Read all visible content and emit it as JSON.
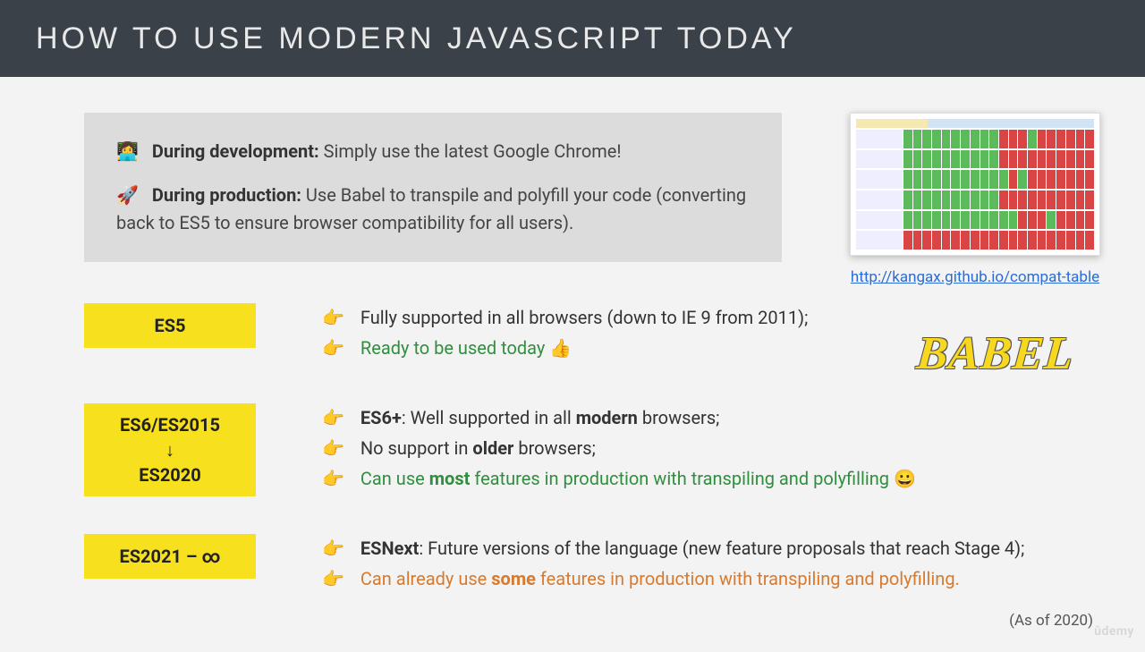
{
  "header": {
    "title": "How to use modern JavaScript today"
  },
  "infobox": {
    "dev_icon": "👩‍💻",
    "dev_label": "During development:",
    "dev_text": "Simply use the latest Google Chrome!",
    "prod_icon": "🚀",
    "prod_label": "During production:",
    "prod_text": "Use Babel to transpile and polyfill your code (converting back to ES5 to ensure browser compatibility for all users)."
  },
  "compat": {
    "link_text": "http://kangax.github.io/compat-table",
    "link_href": "http://kangax.github.io/compat-table"
  },
  "babel_logo_text": "BABEL",
  "tags": {
    "es5": "ES5",
    "es6_l1": "ES6/ES2015",
    "es6_arrow": "↓",
    "es6_l3": "ES2020",
    "esnext": "ES2021 – ∞"
  },
  "bullets": {
    "es5_1": "Fully supported in all browsers (down to IE 9 from 2011);",
    "es5_2_pre": "Ready to be used today ",
    "es5_2_emoji": "👍",
    "es6_1_strong": "ES6+",
    "es6_1_mid": ": Well supported in all ",
    "es6_1_bold": "modern",
    "es6_1_end": " browsers;",
    "es6_2_pre": "No support in ",
    "es6_2_bold": "older",
    "es6_2_end": " browsers;",
    "es6_3_pre": "Can use ",
    "es6_3_bold": "most",
    "es6_3_end": " features in production with transpiling and polyfilling ",
    "es6_3_emoji": "😀",
    "esn_1_strong": "ESNext",
    "esn_1_rest": ": Future versions of the language (new feature proposals that reach Stage 4);",
    "esn_2_pre": "Can already use ",
    "esn_2_bold": "some",
    "esn_2_end": " features in production with transpiling and polyfilling."
  },
  "pointer": "👉",
  "asof": "(As of 2020)",
  "watermark": "ûdemy"
}
